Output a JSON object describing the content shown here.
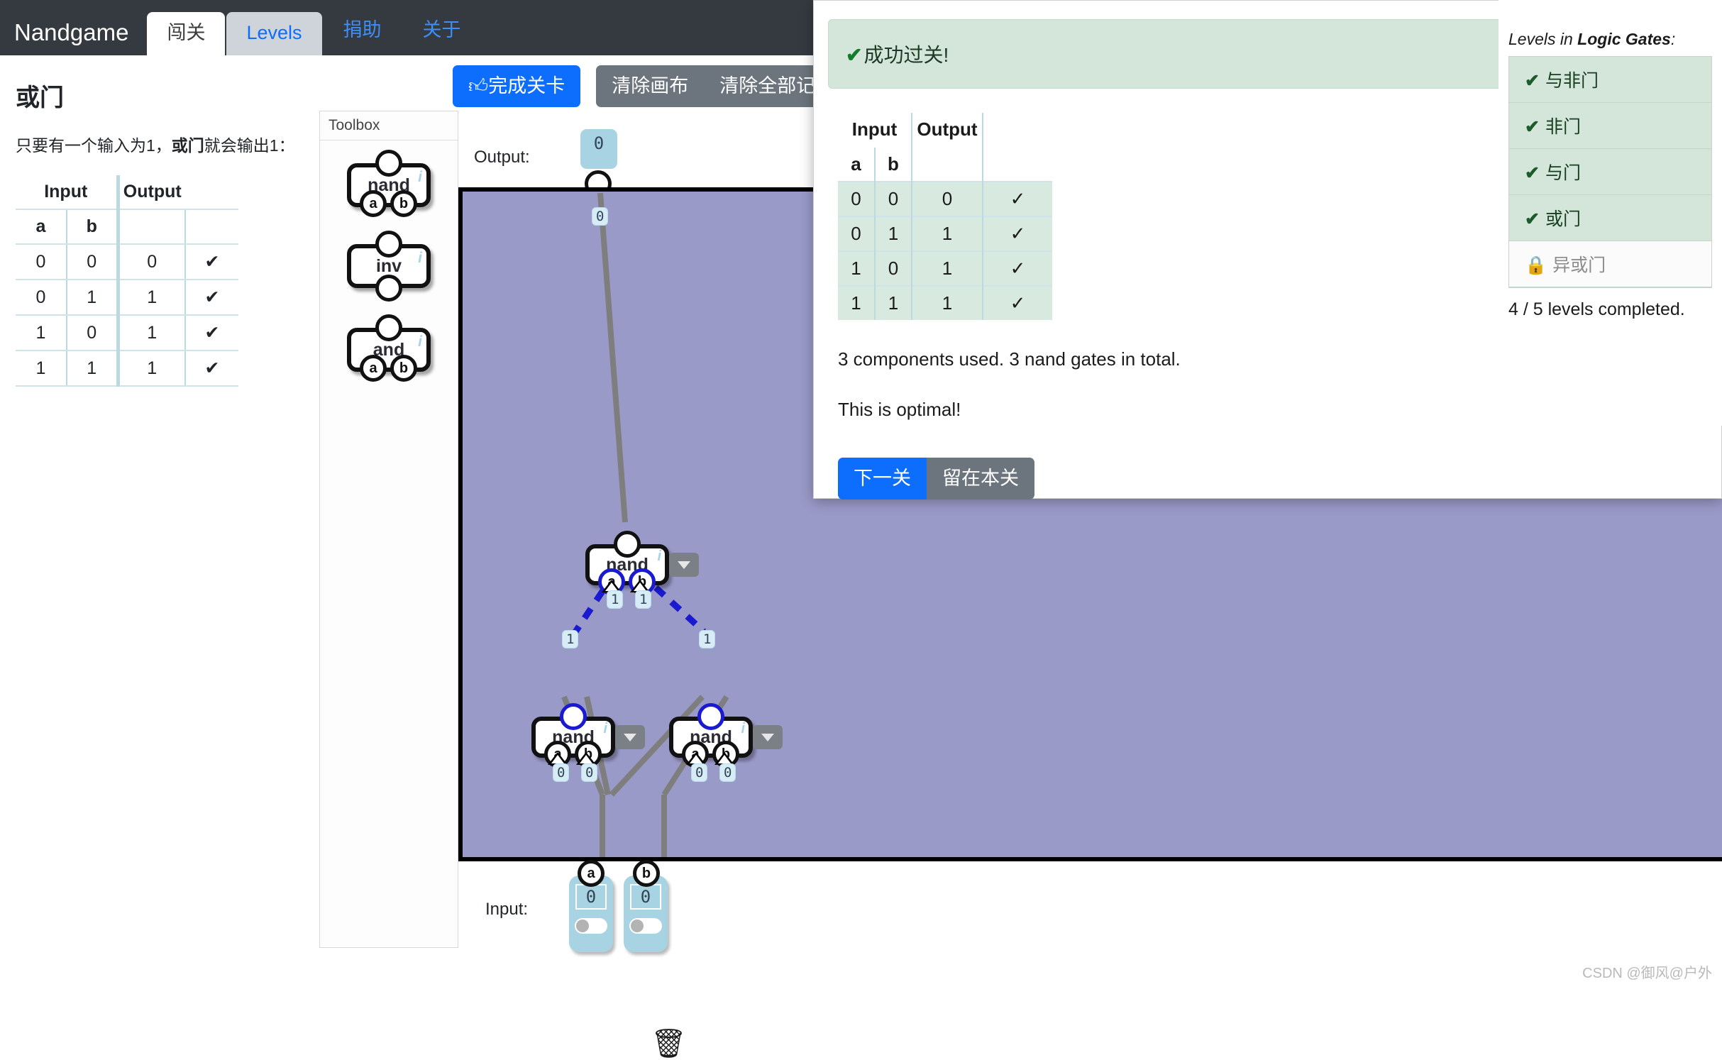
{
  "navbar": {
    "brand": "Nandgame",
    "tabs": [
      {
        "label": "闯关",
        "state": "active"
      },
      {
        "label": "Levels",
        "state": "secondary"
      },
      {
        "label": "捐助",
        "state": "plain"
      },
      {
        "label": "关于",
        "state": "plain"
      }
    ]
  },
  "level": {
    "title": "或门",
    "description_pre": "只要有一个输入为1，",
    "description_bold": "或门",
    "description_post": "就会输出1：",
    "truth_table": {
      "group_headers": [
        "Input",
        "Output"
      ],
      "sub_headers": [
        "a",
        "b"
      ],
      "rows": [
        {
          "a": "0",
          "b": "0",
          "out": "0",
          "check": "✔"
        },
        {
          "a": "0",
          "b": "1",
          "out": "1",
          "check": "✔"
        },
        {
          "a": "1",
          "b": "0",
          "out": "1",
          "check": "✔"
        },
        {
          "a": "1",
          "b": "1",
          "out": "1",
          "check": "✔"
        }
      ]
    }
  },
  "toolbar": {
    "complete_label": "完成关卡",
    "complete_icon": "thumbs-up-icon",
    "clear_canvas_label": "清除画布",
    "clear_all_label": "清除全部记录"
  },
  "toolbox": {
    "header": "Toolbox",
    "gates": [
      {
        "name": "nand",
        "info": "i",
        "pins": [
          "a",
          "b"
        ]
      },
      {
        "name": "inv",
        "info": "i",
        "pins": []
      },
      {
        "name": "and",
        "info": "i",
        "pins": [
          "a",
          "b"
        ]
      }
    ]
  },
  "canvas": {
    "output_label": "Output:",
    "input_label": "Input:",
    "output_value": "0",
    "trash_icon": "trash-icon",
    "gates": [
      {
        "name": "nand",
        "info": "i",
        "pin_a": "a",
        "pin_b": "b",
        "out_value": "0",
        "a_value": "1",
        "b_value": "1"
      },
      {
        "name": "nand",
        "info": "i",
        "pin_a": "a",
        "pin_b": "b",
        "out_value": "1",
        "a_value": "0",
        "b_value": "0"
      },
      {
        "name": "nand",
        "info": "i",
        "pin_a": "a",
        "pin_b": "b",
        "out_value": "1",
        "a_value": "0",
        "b_value": "0"
      }
    ],
    "inputs": [
      {
        "pin": "a",
        "value": "0"
      },
      {
        "pin": "b",
        "value": "0"
      }
    ]
  },
  "modal": {
    "success_text": "成功过关!",
    "success_icon": "check-icon",
    "table": {
      "group_headers": [
        "Input",
        "Output"
      ],
      "sub_headers": [
        "a",
        "b"
      ],
      "rows": [
        {
          "a": "0",
          "b": "0",
          "out": "0",
          "check": "✓"
        },
        {
          "a": "0",
          "b": "1",
          "out": "1",
          "check": "✓"
        },
        {
          "a": "1",
          "b": "0",
          "out": "1",
          "check": "✓"
        },
        {
          "a": "1",
          "b": "1",
          "out": "1",
          "check": "✓"
        }
      ]
    },
    "components_text": "3 components used. 3 nand gates in total.",
    "optimal_text": "This is optimal!",
    "next_label": "下一关",
    "stay_label": "留在本关"
  },
  "sidebar": {
    "title_pre": "Levels in ",
    "title_bold": "Logic Gates",
    "title_post": ":",
    "items": [
      {
        "label": "与非门",
        "completed": true,
        "mark": "✔"
      },
      {
        "label": "非门",
        "completed": true,
        "mark": "✔"
      },
      {
        "label": "与门",
        "completed": true,
        "mark": "✔"
      },
      {
        "label": "或门",
        "completed": true,
        "mark": "✔"
      },
      {
        "label": "异或门",
        "completed": false,
        "mark": "🔒"
      }
    ],
    "summary": "4 / 5 levels completed."
  },
  "watermark": "CSDN @御风@户外",
  "colors": {
    "nav_bg": "#343a40",
    "primary": "#0d6efd",
    "secondary": "#6c757d",
    "canvas_bg": "#9a9ac9",
    "success_bg": "#d4e6d9"
  }
}
